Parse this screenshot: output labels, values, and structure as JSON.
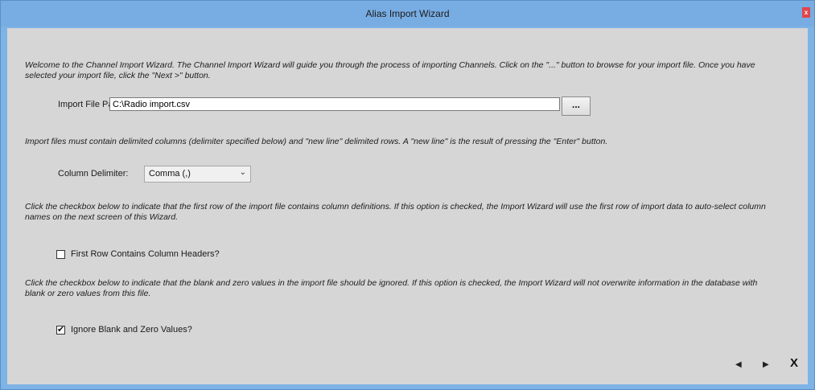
{
  "window": {
    "title": "Alias Import Wizard",
    "close_glyph": "x"
  },
  "intro_text": "Welcome to the Channel Import Wizard.  The Channel Import Wizard will guide you through the process of importing Channels.  Click on the \"...\" button to browse for your import file.  Once you have selected your import file, click the \"Next >\" button.",
  "import_path": {
    "label": "Import File Path:",
    "value": "C:\\Radio import.csv",
    "browse_label": "..."
  },
  "delimited_text": "Import files must contain delimited columns (delimiter specified below) and \"new line\" delimited rows.  A \"new line\" is the result of pressing the \"Enter\" button.",
  "delimiter": {
    "label": "Column Delimiter:",
    "selected": "Comma (,)"
  },
  "header_info_text": "Click the checkbox below to indicate that the first row of the import file contains column definitions.  If this option is checked, the Import Wizard will use the first row of import data to auto-select column names on the next screen of this Wizard.",
  "first_row_headers": {
    "label": "First Row Contains Column Headers?",
    "checked": false
  },
  "ignore_info_text": "Click the checkbox below to indicate that the blank and zero values in the import file should be ignored.  If this option is checked, the Import Wizard will not overwrite information in the database with blank or zero values from this file.",
  "ignore_blank": {
    "label": "Ignore Blank and Zero Values?",
    "checked": true
  },
  "nav": {
    "back_glyph": "◀",
    "next_glyph": "▶",
    "close_glyph": "X"
  }
}
